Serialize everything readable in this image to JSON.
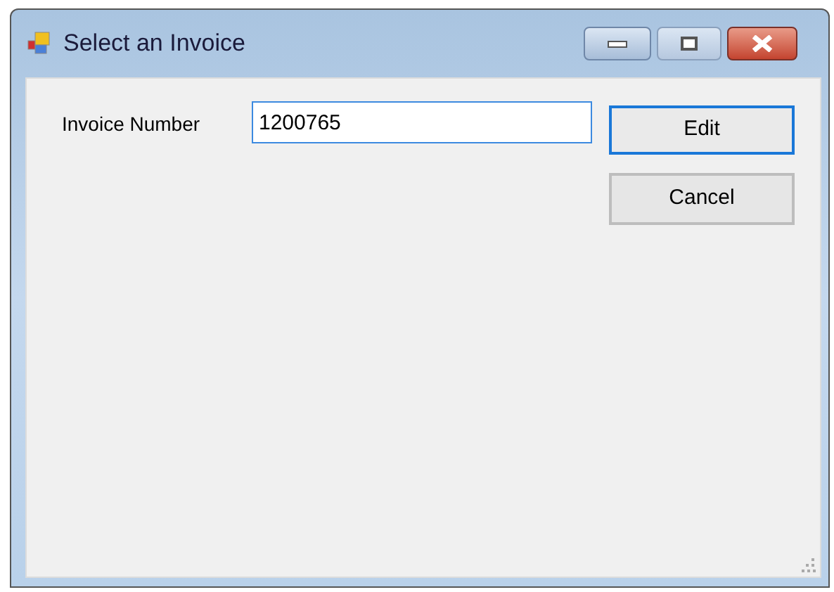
{
  "window": {
    "title": "Select an Invoice"
  },
  "form": {
    "label": "Invoice Number",
    "field_value": "1200765"
  },
  "buttons": [
    {
      "label": "Edit",
      "default": true
    },
    {
      "label": "Cancel",
      "default": false
    }
  ]
}
